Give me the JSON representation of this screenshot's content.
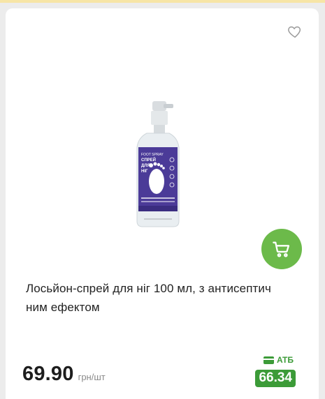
{
  "product": {
    "title": "Лосьйон-спрей для ніг 100 мл, з антисептичним ефектом",
    "title_line1": "Лосьйон-спрей для ніг 100 мл, з антисептич",
    "title_line2": "ним ефектом",
    "image_label_lines": [
      "FOOT SPRAY",
      "СПРЕЙ",
      "ДЛЯ",
      "НІГ"
    ],
    "price": "69.90",
    "price_unit": "грн/шт",
    "promo_label": "АТБ",
    "promo_price": "66.34"
  },
  "icons": {
    "favorite": "heart-icon",
    "cart": "shopping-cart-icon",
    "card": "bank-card-icon"
  },
  "colors": {
    "accent_green": "#6cba4a",
    "promo_green": "#3c9b38",
    "label_purple": "#4b3b98"
  }
}
